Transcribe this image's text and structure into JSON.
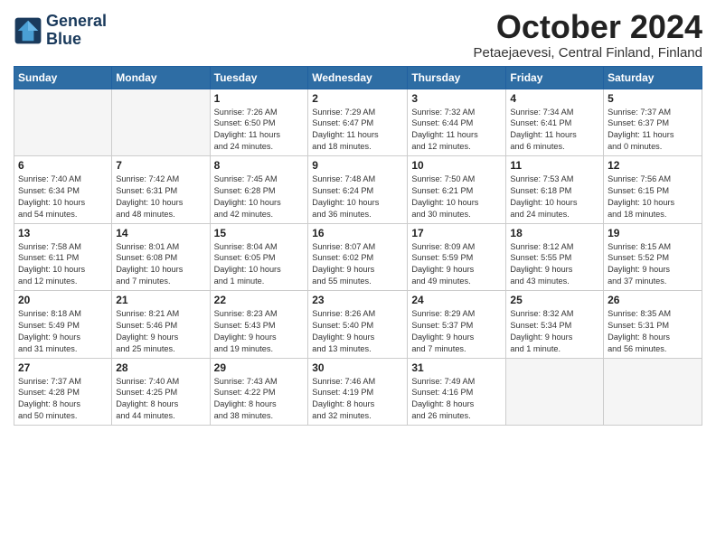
{
  "logo": {
    "line1": "General",
    "line2": "Blue"
  },
  "title": "October 2024",
  "subtitle": "Petaejaevesi, Central Finland, Finland",
  "header_days": [
    "Sunday",
    "Monday",
    "Tuesday",
    "Wednesday",
    "Thursday",
    "Friday",
    "Saturday"
  ],
  "weeks": [
    [
      {
        "day": "",
        "info": ""
      },
      {
        "day": "",
        "info": ""
      },
      {
        "day": "1",
        "info": "Sunrise: 7:26 AM\nSunset: 6:50 PM\nDaylight: 11 hours\nand 24 minutes."
      },
      {
        "day": "2",
        "info": "Sunrise: 7:29 AM\nSunset: 6:47 PM\nDaylight: 11 hours\nand 18 minutes."
      },
      {
        "day": "3",
        "info": "Sunrise: 7:32 AM\nSunset: 6:44 PM\nDaylight: 11 hours\nand 12 minutes."
      },
      {
        "day": "4",
        "info": "Sunrise: 7:34 AM\nSunset: 6:41 PM\nDaylight: 11 hours\nand 6 minutes."
      },
      {
        "day": "5",
        "info": "Sunrise: 7:37 AM\nSunset: 6:37 PM\nDaylight: 11 hours\nand 0 minutes."
      }
    ],
    [
      {
        "day": "6",
        "info": "Sunrise: 7:40 AM\nSunset: 6:34 PM\nDaylight: 10 hours\nand 54 minutes."
      },
      {
        "day": "7",
        "info": "Sunrise: 7:42 AM\nSunset: 6:31 PM\nDaylight: 10 hours\nand 48 minutes."
      },
      {
        "day": "8",
        "info": "Sunrise: 7:45 AM\nSunset: 6:28 PM\nDaylight: 10 hours\nand 42 minutes."
      },
      {
        "day": "9",
        "info": "Sunrise: 7:48 AM\nSunset: 6:24 PM\nDaylight: 10 hours\nand 36 minutes."
      },
      {
        "day": "10",
        "info": "Sunrise: 7:50 AM\nSunset: 6:21 PM\nDaylight: 10 hours\nand 30 minutes."
      },
      {
        "day": "11",
        "info": "Sunrise: 7:53 AM\nSunset: 6:18 PM\nDaylight: 10 hours\nand 24 minutes."
      },
      {
        "day": "12",
        "info": "Sunrise: 7:56 AM\nSunset: 6:15 PM\nDaylight: 10 hours\nand 18 minutes."
      }
    ],
    [
      {
        "day": "13",
        "info": "Sunrise: 7:58 AM\nSunset: 6:11 PM\nDaylight: 10 hours\nand 12 minutes."
      },
      {
        "day": "14",
        "info": "Sunrise: 8:01 AM\nSunset: 6:08 PM\nDaylight: 10 hours\nand 7 minutes."
      },
      {
        "day": "15",
        "info": "Sunrise: 8:04 AM\nSunset: 6:05 PM\nDaylight: 10 hours\nand 1 minute."
      },
      {
        "day": "16",
        "info": "Sunrise: 8:07 AM\nSunset: 6:02 PM\nDaylight: 9 hours\nand 55 minutes."
      },
      {
        "day": "17",
        "info": "Sunrise: 8:09 AM\nSunset: 5:59 PM\nDaylight: 9 hours\nand 49 minutes."
      },
      {
        "day": "18",
        "info": "Sunrise: 8:12 AM\nSunset: 5:55 PM\nDaylight: 9 hours\nand 43 minutes."
      },
      {
        "day": "19",
        "info": "Sunrise: 8:15 AM\nSunset: 5:52 PM\nDaylight: 9 hours\nand 37 minutes."
      }
    ],
    [
      {
        "day": "20",
        "info": "Sunrise: 8:18 AM\nSunset: 5:49 PM\nDaylight: 9 hours\nand 31 minutes."
      },
      {
        "day": "21",
        "info": "Sunrise: 8:21 AM\nSunset: 5:46 PM\nDaylight: 9 hours\nand 25 minutes."
      },
      {
        "day": "22",
        "info": "Sunrise: 8:23 AM\nSunset: 5:43 PM\nDaylight: 9 hours\nand 19 minutes."
      },
      {
        "day": "23",
        "info": "Sunrise: 8:26 AM\nSunset: 5:40 PM\nDaylight: 9 hours\nand 13 minutes."
      },
      {
        "day": "24",
        "info": "Sunrise: 8:29 AM\nSunset: 5:37 PM\nDaylight: 9 hours\nand 7 minutes."
      },
      {
        "day": "25",
        "info": "Sunrise: 8:32 AM\nSunset: 5:34 PM\nDaylight: 9 hours\nand 1 minute."
      },
      {
        "day": "26",
        "info": "Sunrise: 8:35 AM\nSunset: 5:31 PM\nDaylight: 8 hours\nand 56 minutes."
      }
    ],
    [
      {
        "day": "27",
        "info": "Sunrise: 7:37 AM\nSunset: 4:28 PM\nDaylight: 8 hours\nand 50 minutes."
      },
      {
        "day": "28",
        "info": "Sunrise: 7:40 AM\nSunset: 4:25 PM\nDaylight: 8 hours\nand 44 minutes."
      },
      {
        "day": "29",
        "info": "Sunrise: 7:43 AM\nSunset: 4:22 PM\nDaylight: 8 hours\nand 38 minutes."
      },
      {
        "day": "30",
        "info": "Sunrise: 7:46 AM\nSunset: 4:19 PM\nDaylight: 8 hours\nand 32 minutes."
      },
      {
        "day": "31",
        "info": "Sunrise: 7:49 AM\nSunset: 4:16 PM\nDaylight: 8 hours\nand 26 minutes."
      },
      {
        "day": "",
        "info": ""
      },
      {
        "day": "",
        "info": ""
      }
    ]
  ]
}
